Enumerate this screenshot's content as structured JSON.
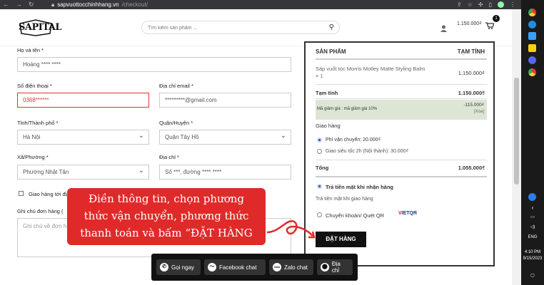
{
  "browser": {
    "back_icon": "back-arrow-icon",
    "forward_icon": "forward-arrow-icon",
    "reload_icon": "reload-icon",
    "url_host": "sapvuottocchinhhang.vn",
    "url_path": "/checkout/"
  },
  "header": {
    "logo_text": "SAPITAL",
    "search_placeholder": "Tìm kiếm sản phẩm ...",
    "cart_total": "1.150.000₫",
    "cart_count": "1"
  },
  "form": {
    "name_label": "Họ và tên *",
    "name_value": "Hoàng **** ****",
    "phone_label": "Số điện thoại *",
    "phone_value": "0368******",
    "email_label": "Địa chỉ email *",
    "email_value": "*********@gmail.com",
    "city_label": "Tỉnh/Thành phố *",
    "city_value": "Hà Nội",
    "district_label": "Quận/Huyện *",
    "district_value": "Quận Tây Hồ",
    "ward_label": "Xã/Phường *",
    "ward_value": "Phường Nhật Tân",
    "address_label": "Địa chỉ *",
    "address_value": "Số ***, đường **** ****",
    "ship_other_label": "Giao hàng tới địa",
    "notes_label": "Ghi chú đơn hàng (",
    "notes_placeholder": "Ghi chú về đơn h"
  },
  "order": {
    "col_product": "SẢN PHẨM",
    "col_subtotal": "TẠM TÍNH",
    "item_name_line1": "Sáp vuốt tóc Morris Motley Matte Styling Balm",
    "item_name_line2": "× 1",
    "item_price": "1.150.000₫",
    "subtotal_label": "Tạm tính",
    "subtotal_value": "1.150.000₫",
    "discount_label": "Mã giảm giá : mã giảm giá 10%",
    "discount_value": "-115.000₫",
    "discount_remove": "[Xóa]",
    "shipping_label": "Giao hàng",
    "shipping_opt1": "Phí vận chuyển: 20.000₫",
    "shipping_opt2": "Giao siêu tốc 2h (Nội thành): 30.000₫",
    "total_label": "Tổng",
    "total_value": "1.055.000₫",
    "pay_cod_label": "Trả tiền mặt khi nhận hàng",
    "pay_cod_desc": "Trả tiền mặt khi giao hàng",
    "pay_transfer_label": "Chuyển khoản/ Quét QR",
    "vietqr_v": "V",
    "vietqr_rest": "IETQR",
    "order_button": "ĐẶT HÀNG"
  },
  "callout": {
    "text_line1": "Điền thông tin, chọn phương",
    "text_line2": "thức vận chuyển, phương thức",
    "text_line3": "thanh toán và bấm “ĐẶT HÀNG"
  },
  "chatbar": {
    "call_label": "Gọi ngay",
    "facebook_label": "Facebook chat",
    "zalo_label": "Zalo chat",
    "zalo_icon_text": "Zalo",
    "address_label": "Địa chỉ"
  },
  "taskbar": {
    "lang": "ENG",
    "time": "4:10 PM",
    "date": "9/15/2023"
  }
}
